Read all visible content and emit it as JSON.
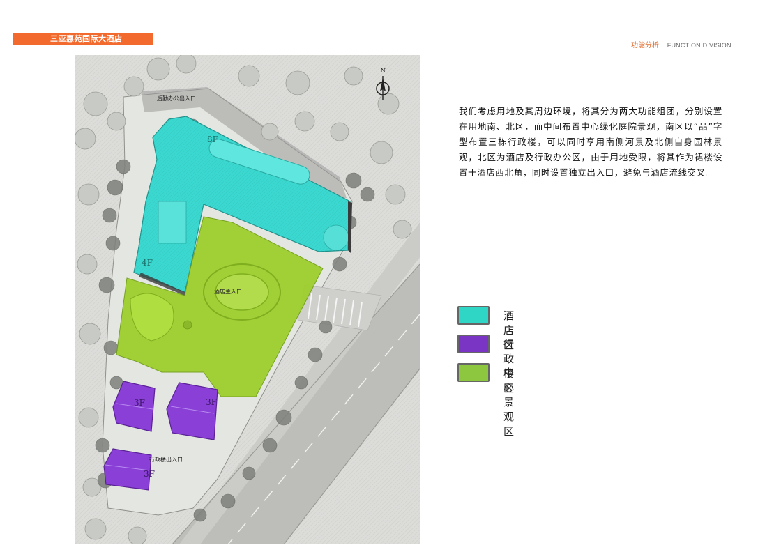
{
  "header": {
    "project_title": "三亚惠苑国际大酒店",
    "section_cn": "功能分析",
    "section_en": "FUNCTION DIVISION"
  },
  "plan": {
    "north_label": "N",
    "labels": {
      "service_entrance": "后勤办公出入口",
      "hotel_main_entrance": "酒店主入口",
      "admin_entrance": "行政楼出入口",
      "floors_hotel_main": "8F",
      "floors_hotel_podium": "4F",
      "floors_admin_1": "3F",
      "floors_admin_2": "3F",
      "floors_admin_3": "3F"
    }
  },
  "description": "我们考虑用地及其周边环境，将其分为两大功能组团，分别设置在用地南、北区，而中间布置中心绿化庭院景观，南区以“品”字型布置三栋行政楼，可以同时享用南侧河景及北侧自身园林景观，北区为酒店及行政办公区，由于用地受限，将其作为裙楼设置于酒店西北角，同时设置独立出入口，避免与酒店流线交叉。",
  "legend": [
    {
      "label": "酒店区",
      "color": "#2fd5c5"
    },
    {
      "label": "行政楼区",
      "color": "#7a35c4"
    },
    {
      "label": "中心景观区",
      "color": "#8dc63f"
    }
  ],
  "colors": {
    "accent": "#f26a2e",
    "hotel": "#3ad8d0",
    "admin": "#8a3fd6",
    "landscape": "#9ccf2a",
    "site": "#dcdcd9",
    "road": "#b9b9b6"
  }
}
